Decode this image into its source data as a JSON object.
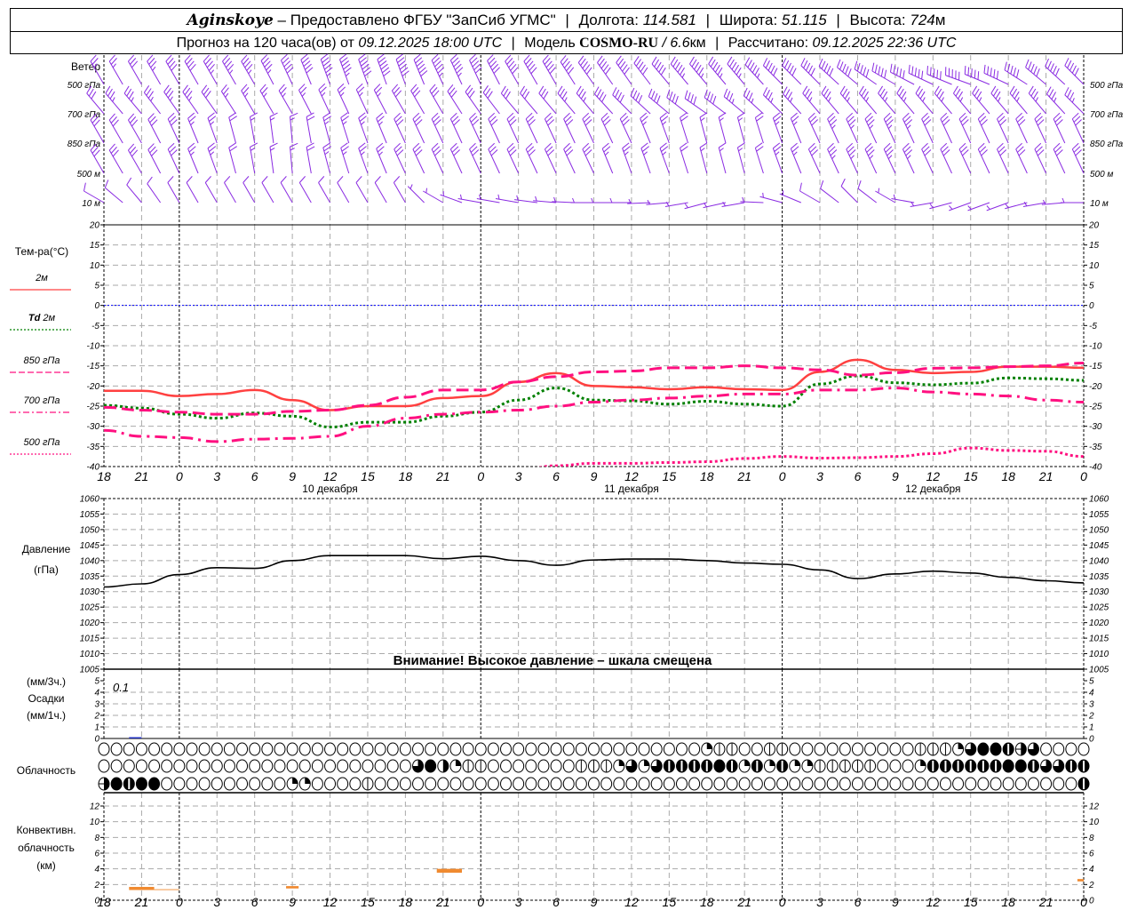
{
  "header": {
    "location": "Aginskoye",
    "provider": "– Предоставлено ФГБУ \"ЗапСиб УГМС\"",
    "lon_label": "Долгота:",
    "lon": "114.581",
    "lat_label": "Широта:",
    "lat": "51.115",
    "alt_label": "Высота:",
    "alt": "724",
    "alt_unit": "м",
    "forecast_label": "Прогноз на 120 часа(ов) от",
    "forecast_from": "09.12.2025 18:00 UTC",
    "model_label": "Модель",
    "model": "COSMO-RU",
    "model_res": "/ 6.6",
    "model_res_unit": "км",
    "computed_label": "Рассчитано:",
    "computed": "09.12.2025 22:36 UTC"
  },
  "colors": {
    "wind": "#8a2be2",
    "t2m": "#ff4040",
    "td2m": "#008000",
    "upper": "#ff1080",
    "zero_line": "#0000ff",
    "convective": "#f08a30",
    "precip": "#2030c0"
  },
  "x_ticks": [
    "18",
    "21",
    "0",
    "3",
    "6",
    "9",
    "12",
    "15",
    "18",
    "21",
    "0",
    "3",
    "6",
    "9",
    "12",
    "15",
    "18",
    "21",
    "0",
    "3",
    "6",
    "9",
    "12",
    "15",
    "18",
    "21",
    "0"
  ],
  "day_labels": [
    {
      "label": "10 декабря",
      "tick": 6
    },
    {
      "label": "11 декабря",
      "tick": 14
    },
    {
      "label": "12 декабря",
      "tick": 22
    }
  ],
  "wind": {
    "title": "Ветер",
    "levels": [
      {
        "label": "500 гПа",
        "dir": [
          330,
          330,
          330,
          330,
          330,
          335,
          340,
          340,
          340,
          335,
          335,
          330,
          330,
          325,
          325,
          320,
          320,
          320,
          315,
          315,
          310,
          300,
          295,
          290,
          295,
          310,
          315
        ],
        "speed": [
          12,
          15,
          20,
          22,
          22,
          25,
          27,
          30,
          30,
          28,
          25,
          25,
          25,
          25,
          25,
          25,
          28,
          28,
          25,
          25,
          25,
          25,
          25,
          25,
          25,
          25,
          25
        ]
      },
      {
        "label": "700 гПа",
        "dir": [
          320,
          320,
          325,
          325,
          330,
          330,
          335,
          335,
          330,
          330,
          325,
          320,
          320,
          320,
          315,
          310,
          305,
          310,
          315,
          320,
          320,
          320,
          320,
          320,
          320,
          320,
          315
        ],
        "speed": [
          15,
          18,
          18,
          15,
          12,
          12,
          12,
          12,
          15,
          15,
          15,
          15,
          15,
          18,
          20,
          20,
          20,
          18,
          18,
          18,
          18,
          18,
          18,
          18,
          18,
          18,
          18
        ]
      },
      {
        "label": "850 гПа",
        "dir": [
          330,
          330,
          335,
          340,
          350,
          355,
          345,
          340,
          335,
          335,
          335,
          335,
          335,
          335,
          335,
          340,
          345,
          345,
          340,
          335,
          335,
          335,
          335,
          335,
          335,
          335,
          335
        ],
        "speed": [
          15,
          15,
          15,
          12,
          8,
          8,
          12,
          12,
          15,
          15,
          15,
          15,
          15,
          15,
          15,
          12,
          8,
          8,
          12,
          15,
          18,
          18,
          15,
          15,
          15,
          15,
          15
        ]
      },
      {
        "label": "500 м",
        "dir": [
          330,
          330,
          335,
          340,
          350,
          355,
          345,
          340,
          335,
          335,
          335,
          335,
          335,
          335,
          340,
          340,
          345,
          345,
          340,
          335,
          335,
          335,
          335,
          335,
          335,
          335,
          335
        ],
        "speed": [
          15,
          15,
          15,
          12,
          8,
          8,
          12,
          12,
          15,
          15,
          15,
          15,
          15,
          15,
          12,
          12,
          8,
          8,
          12,
          15,
          18,
          18,
          15,
          15,
          15,
          15,
          15
        ]
      },
      {
        "label": "10  м",
        "dir": [
          300,
          320,
          330,
          330,
          330,
          330,
          330,
          330,
          330,
          300,
          280,
          280,
          275,
          270,
          270,
          265,
          255,
          260,
          285,
          300,
          315,
          300,
          260,
          250,
          250,
          260,
          270
        ],
        "speed": [
          4,
          5,
          6,
          6,
          6,
          6,
          6,
          5,
          4,
          3,
          3,
          3,
          3,
          2,
          2,
          2,
          2,
          2,
          3,
          4,
          5,
          3,
          2,
          2,
          2,
          2,
          2
        ]
      }
    ]
  },
  "chart_data": [
    {
      "type": "line",
      "ylabel": "Тем-ра(°C)",
      "ylim": [
        -40,
        20
      ],
      "yticks": [
        20,
        15,
        10,
        5,
        0,
        -5,
        -10,
        -15,
        -20,
        -25,
        -30,
        -35,
        -40
      ],
      "grid": true,
      "series": [
        {
          "name": "2м",
          "legend_prefix": "",
          "values": [
            -21.2,
            -21.2,
            -22.5,
            -22,
            -21,
            -23.5,
            -26,
            -25,
            -25,
            -23,
            -22.5,
            -19,
            -16.8,
            -20,
            -20.3,
            -20.8,
            -20.3,
            -20.8,
            -21,
            -16.5,
            -13.5,
            -16,
            -16.8,
            -16.5,
            -15.2,
            -15.2,
            -15.5
          ]
        },
        {
          "name": "2м",
          "legend_prefix": "Td",
          "values": [
            -24.8,
            -25.5,
            -27,
            -28,
            -26.7,
            -27.5,
            -30.2,
            -29,
            -29,
            -27.5,
            -26.5,
            -23.5,
            -20.5,
            -23.5,
            -23.7,
            -24.5,
            -23.8,
            -24.5,
            -25,
            -19.5,
            -17.5,
            -19.2,
            -19.7,
            -19.3,
            -18,
            -18.2,
            -18.6
          ]
        },
        {
          "name": "850 гПа",
          "legend_prefix": "",
          "values": [
            -25.3,
            -26,
            -26.5,
            -27,
            -27,
            -26.3,
            -26,
            -24.8,
            -22.8,
            -21,
            -21,
            -19,
            -17.7,
            -16.5,
            -16.3,
            -15.5,
            -15.5,
            -15,
            -15.5,
            -16,
            -17.3,
            -16.7,
            -15.6,
            -15.5,
            -15.2,
            -15,
            -14.3
          ]
        },
        {
          "name": "700 гПа",
          "legend_prefix": "",
          "values": [
            -31,
            -32.5,
            -32.8,
            -33.8,
            -33.2,
            -33,
            -32.5,
            -30,
            -28,
            -27,
            -26.5,
            -26,
            -25,
            -24,
            -23.5,
            -23,
            -22.5,
            -22,
            -22,
            -21,
            -21,
            -20.5,
            -21.5,
            -22,
            -22.5,
            -23.5,
            -24
          ]
        },
        {
          "name": "500 гПа",
          "legend_prefix": "",
          "values": [
            -44,
            -44,
            -44,
            -44,
            -44,
            -44,
            -44,
            -44,
            -44,
            -44,
            -42,
            -41,
            -39.8,
            -39.2,
            -39.2,
            -39,
            -38.8,
            -38,
            -37.5,
            -37.9,
            -37.8,
            -37.5,
            -36.8,
            -35.4,
            -36,
            -36.2,
            -37.5
          ]
        }
      ]
    },
    {
      "type": "line",
      "ylabel": "Давление",
      "yunit": "(гПа)",
      "ylim": [
        1005,
        1060
      ],
      "yticks": [
        1060,
        1055,
        1050,
        1045,
        1040,
        1035,
        1030,
        1025,
        1020,
        1015,
        1010,
        1005
      ],
      "grid": true,
      "annotation": "Внимание! Высокое давление – шкала смещена",
      "values": [
        1031.5,
        1032.5,
        1035.5,
        1037.7,
        1037.5,
        1040,
        1041.6,
        1041.6,
        1041.6,
        1040.6,
        1041.4,
        1040,
        1038.5,
        1040.2,
        1040.5,
        1040.5,
        1040,
        1039.2,
        1038.8,
        1037,
        1034.2,
        1035.7,
        1036.6,
        1036,
        1034.6,
        1033.5,
        1032.8
      ]
    },
    {
      "type": "bar",
      "ylabel": "Осадки",
      "yunit_top": "(мм/3ч.)",
      "yunit_bottom": "(мм/1ч.)",
      "ylim": [
        0,
        5
      ],
      "yticks": [
        5,
        4,
        3,
        2,
        1,
        0
      ],
      "annotation": "0.1",
      "bars": [
        {
          "start": "09.12 20:00",
          "end": "09.12 21:00",
          "value": 0.05
        }
      ]
    },
    {
      "type": "table",
      "ylabel": "Облачность",
      "rows": [
        "0000000000000000000000000000000000000000000000002110011000000000011126887960000",
        "0000000000000000000000000684211000000011126267777872727221111100027777778876677",
        "9878800000000002200001000000000000000000000000000000000000000000000000000000007"
      ]
    },
    {
      "type": "bar",
      "ylabel": "Конвективн.",
      "ylabel2": "облачность",
      "yunit": "(км)",
      "ylim": [
        0,
        13
      ],
      "yticks": [
        12,
        10,
        8,
        6,
        4,
        2,
        0
      ],
      "bars": [
        {
          "start": "09.12 20:00",
          "end": "09.12 22:00",
          "base": 1.3,
          "top": 1.7
        },
        {
          "start": "09.12 22:00",
          "end": "10.12 00:00",
          "base": 1.3,
          "top": 1.4
        },
        {
          "start": "10.12 08:30",
          "end": "10.12 09:30",
          "base": 1.5,
          "top": 1.8
        },
        {
          "start": "10.12 20:30",
          "end": "10.12 22:30",
          "base": 3.5,
          "top": 4.0
        },
        {
          "start": "12.12 23:30",
          "end": "13.12 00:00",
          "base": 2.4,
          "top": 2.7
        }
      ]
    }
  ]
}
